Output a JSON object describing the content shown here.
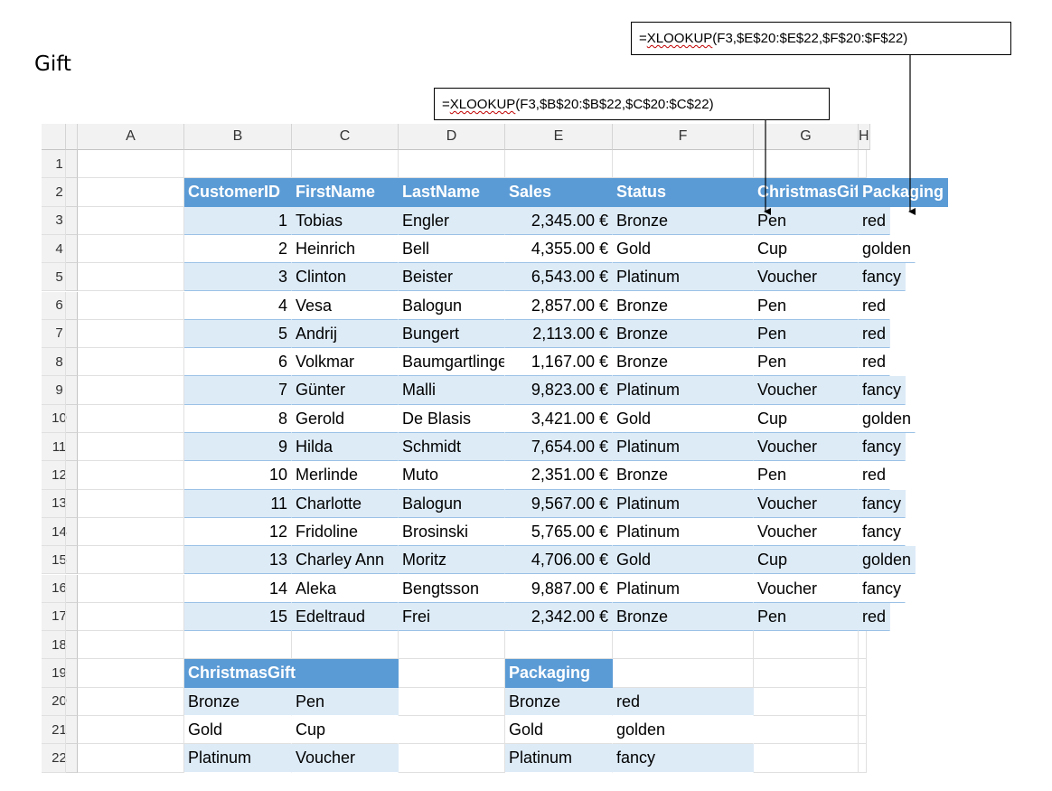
{
  "slide": {
    "title": "Gift"
  },
  "callouts": {
    "packaging": {
      "fn": "XLOOKUP",
      "prefix": "=",
      "rest": "(F3,$E$20:$E$22,$F$20:$F$22)"
    },
    "gift": {
      "fn": "XLOOKUP",
      "prefix": "=",
      "rest": "(F3,$B$20:$B$22,$C$20:$C$22)"
    }
  },
  "sheet": {
    "columns": [
      "A",
      "B",
      "C",
      "D",
      "E",
      "F",
      "G",
      "H"
    ],
    "rows": [
      "1",
      "2",
      "3",
      "4",
      "5",
      "6",
      "7",
      "8",
      "9",
      "10",
      "11",
      "12",
      "13",
      "14",
      "15",
      "16",
      "17",
      "18",
      "19",
      "20",
      "21",
      "22"
    ],
    "table_headers": [
      "CustomerID",
      "FirstName",
      "LastName",
      "Sales",
      "Status",
      "ChristmasGift",
      "Packaging"
    ],
    "table_rows": [
      [
        "1",
        "Tobias",
        "Engler",
        "2,345.00 €",
        "Bronze",
        "Pen",
        "red"
      ],
      [
        "2",
        "Heinrich",
        "Bell",
        "4,355.00 €",
        "Gold",
        "Cup",
        "golden"
      ],
      [
        "3",
        "Clinton",
        "Beister",
        "6,543.00 €",
        "Platinum",
        "Voucher",
        "fancy"
      ],
      [
        "4",
        "Vesa",
        "Balogun",
        "2,857.00 €",
        "Bronze",
        "Pen",
        "red"
      ],
      [
        "5",
        "Andrij",
        "Bungert",
        "2,113.00 €",
        "Bronze",
        "Pen",
        "red"
      ],
      [
        "6",
        "Volkmar",
        "Baumgartlinger",
        "1,167.00 €",
        "Bronze",
        "Pen",
        "red"
      ],
      [
        "7",
        "Günter",
        "Malli",
        "9,823.00 €",
        "Platinum",
        "Voucher",
        "fancy"
      ],
      [
        "8",
        "Gerold",
        "De Blasis",
        "3,421.00 €",
        "Gold",
        "Cup",
        "golden"
      ],
      [
        "9",
        "Hilda",
        "Schmidt",
        "7,654.00 €",
        "Platinum",
        "Voucher",
        "fancy"
      ],
      [
        "10",
        "Merlinde",
        "Muto",
        "2,351.00 €",
        "Bronze",
        "Pen",
        "red"
      ],
      [
        "11",
        "Charlotte",
        "Balogun",
        "9,567.00 €",
        "Platinum",
        "Voucher",
        "fancy"
      ],
      [
        "12",
        "Fridoline",
        "Brosinski",
        "5,765.00 €",
        "Platinum",
        "Voucher",
        "fancy"
      ],
      [
        "13",
        "Charley Ann",
        "Moritz",
        "4,706.00 €",
        "Gold",
        "Cup",
        "golden"
      ],
      [
        "14",
        "Aleka",
        "Bengtsson",
        "9,887.00 €",
        "Platinum",
        "Voucher",
        "fancy"
      ],
      [
        "15",
        "Edeltraud",
        "Frei",
        "2,342.00 €",
        "Bronze",
        "Pen",
        "red"
      ]
    ],
    "gift_lookup": {
      "header": "ChristmasGift",
      "rows": [
        [
          "Bronze",
          "Pen"
        ],
        [
          "Gold",
          "Cup"
        ],
        [
          "Platinum",
          "Voucher"
        ]
      ]
    },
    "pack_lookup": {
      "header": "Packaging",
      "rows": [
        [
          "Bronze",
          "red"
        ],
        [
          "Gold",
          "golden"
        ],
        [
          "Platinum",
          "fancy"
        ]
      ]
    }
  },
  "colors": {
    "table_header": "#5b9bd5",
    "band": "#ddebf7",
    "band_border": "#9bc2e6",
    "header_bg": "#f2f2f2"
  }
}
